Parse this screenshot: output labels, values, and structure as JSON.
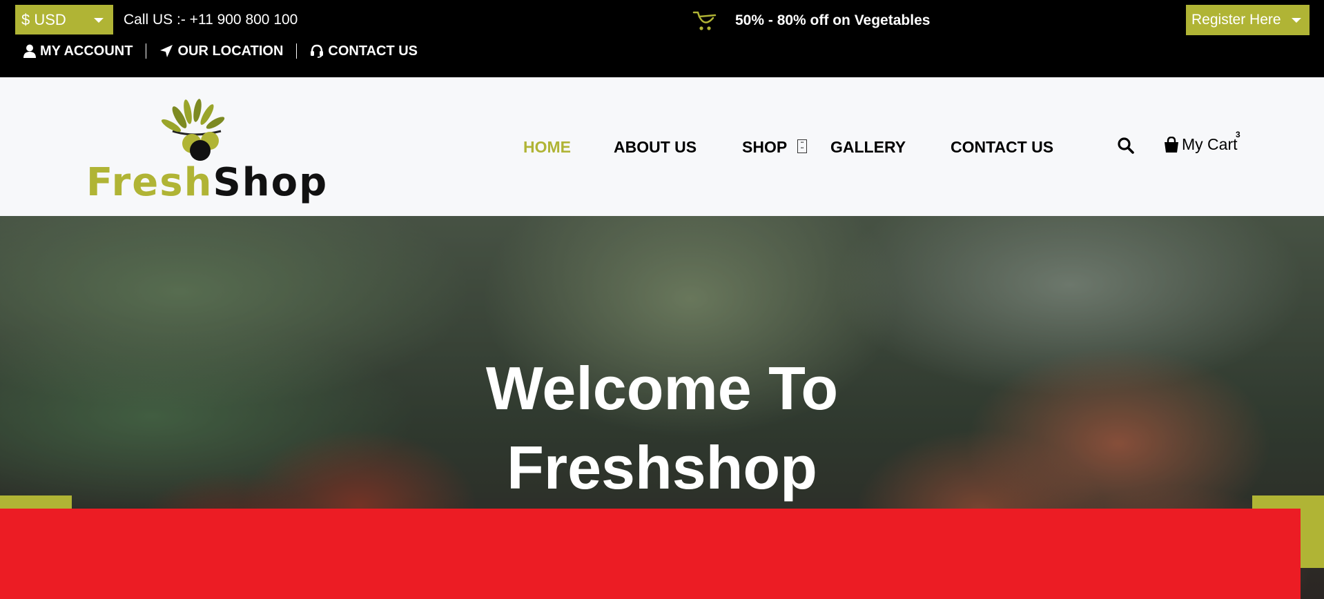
{
  "topbar": {
    "currency_label": "$ USD",
    "call_text": "Call US :- +11 900 800 100",
    "promo_text": "50% - 80% off on Vegetables",
    "promo_icon": "cart-icon",
    "register_label": "Register Here",
    "account_links": [
      {
        "label": "MY ACCOUNT",
        "icon": "user-icon"
      },
      {
        "label": "OUR LOCATION",
        "icon": "location-arrow-icon"
      },
      {
        "label": "CONTACT US",
        "icon": "headset-icon"
      }
    ]
  },
  "header": {
    "logo": {
      "part1": "Fresh",
      "part2": "Shop"
    },
    "nav": [
      {
        "label": "HOME",
        "active": true
      },
      {
        "label": "ABOUT US"
      },
      {
        "label": "SHOP"
      },
      {
        "label": "GALLERY"
      },
      {
        "label": "CONTACT US"
      }
    ],
    "cart": {
      "label": "My Cart",
      "count": "3"
    }
  },
  "hero": {
    "title_line1": "Welcome To",
    "title_line2": "Freshshop"
  },
  "colors": {
    "accent": "#b0b435",
    "topbar_bg": "#000000",
    "header_bg": "#f7f8fa",
    "banner_red": "#ec1c24"
  }
}
